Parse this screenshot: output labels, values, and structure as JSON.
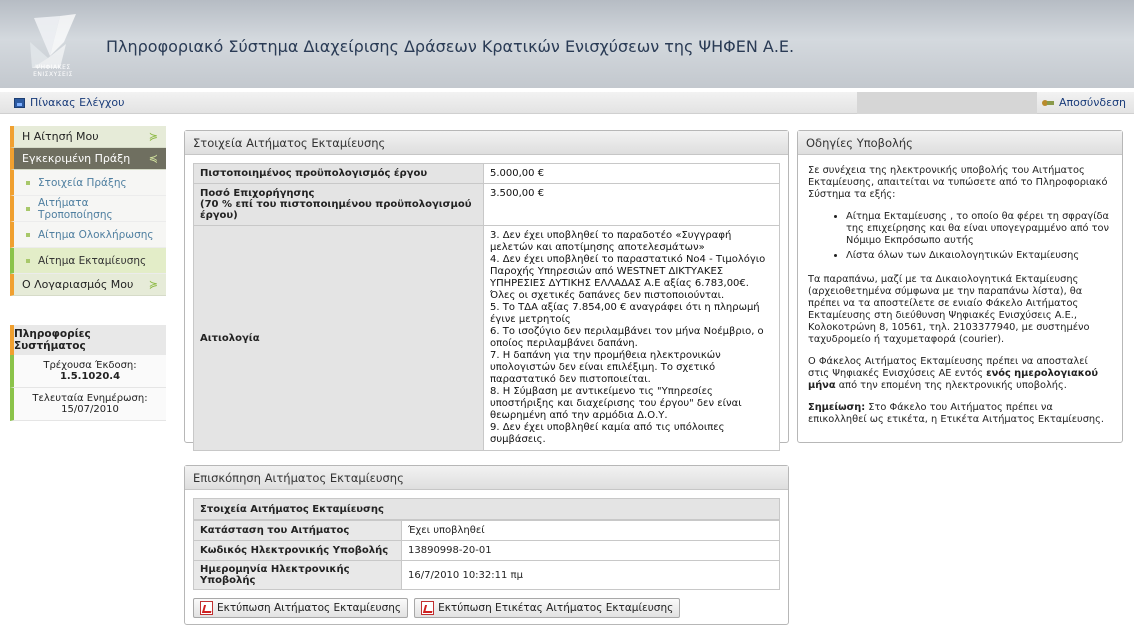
{
  "header": {
    "logo_text": "ΨΗΦΙΑΚΕΣ ΕΝΙΣΧΥΣΕΙΣ",
    "title": "Πληροφοριακό Σύστημα Διαχείρισης Δράσεων Κρατικών Ενισχύσεων της ΨΗΦΕΝ Α.Ε."
  },
  "toolbar": {
    "dashboard": "Πίνακας Ελέγχου",
    "logout": "Αποσύνδεση"
  },
  "nav": {
    "items": [
      {
        "label": "Η Αίτησή Μου",
        "chev": "≽"
      },
      {
        "label": "Εγκεκριμένη Πράξη",
        "chev": "≼"
      }
    ],
    "sub": [
      "Στοιχεία Πράξης",
      "Αιτήματα Τροποποίησης",
      "Αίτημα Ολοκλήρωσης",
      "Αίτημα Εκταμίευσης"
    ],
    "account": {
      "label": "Ο Λογαριασμός Μου",
      "chev": "≽"
    }
  },
  "sysinfo": {
    "title": "Πληροφορίες Συστήματος",
    "version_label": "Τρέχουσα Έκδοση:",
    "version": "1.5.1020.4",
    "update_label": "Τελευταία Ενημέρωση:",
    "update_date": "15/07/2010"
  },
  "main": {
    "title": "Στοιχεία Αιτήματος Εκταμίευσης",
    "budget_label": "Πιστοποιημένος προϋπολογισμός έργου",
    "budget_value": "5.000,00 €",
    "grant_label_1": "Ποσό Επιχορήγησης",
    "grant_label_2": "(70 % επί του πιστοποιημένου προϋπολογισμού έργου)",
    "grant_value": "3.500,00 €",
    "reason_label": "Αιτιολογία",
    "reasons": [
      "3. Δεν έχει υποβληθεί το παραδοτέο «Συγγραφή μελετών και αποτίμησης αποτελεσμάτων»",
      "4. Δεν έχει υποβληθεί το παραστατικό Νο4 - Τιμολόγιο Παροχής Υπηρεσιών από WESTNET ΔΙΚΤΥΑΚΕΣ ΥΠΗΡΕΣΙΕΣ ΔΥΤΙΚΗΣ ΕΛΛΑΔΑΣ Α.Ε αξίας 6.783,00€. Όλες οι σχετικές δαπάνες δεν πιστοποιούνται.",
      "5. Το ΤΔΑ αξίας 7.854,00 € αναγράφει ότι η πληρωμή έγινε μετρητοίς",
      "6. Το ισοζύγιο δεν περιλαμβάνει τον μήνα Νοέμβριο, ο οποίος περιλαμβάνει δαπάνη.",
      "7. Η δαπάνη για την προμήθεια ηλεκτρονικών υπολογιστών δεν είναι επιλέξιμη. Το σχετικό παραστατικό δεν πιστοποιείται.",
      "8. Η Σύμβαση με αντικείμενο τις \"Υπηρεσίες υποστήριξης και διαχείρισης του έργου\" δεν είναι θεωρημένη από την αρμόδια Δ.Ο.Υ.",
      "9. Δεν έχει υποβληθεί καμία από τις υπόλοιπες συμβάσεις."
    ]
  },
  "help": {
    "title": "Οδηγίες Υποβολής",
    "intro": "Σε συνέχεια της ηλεκτρονικής υποβολής του Αιτήματος Εκταμίευσης, απαιτείται να τυπώσετε από το Πληροφοριακό Σύστημα τα εξής:",
    "bullets": [
      "Αίτημα Εκταμίευσης , το οποίο θα φέρει τη σφραγίδα της επιχείρησης και θα είναι υπογεγραμμένο από τον Νόμιμο Εκπρόσωπο αυτής",
      "Λίστα όλων των Δικαιολογητικών Εκταμίευσης"
    ],
    "para2": "Τα παραπάνω, μαζί με τα Δικαιολογητικά Εκταμίευσης (αρχειοθετημένα σύμφωνα με την παραπάνω λίστα), θα πρέπει να τα αποστείλετε σε ενιαίο Φάκελο Αιτήματος Εκταμίευσης στη διεύθυνση Ψηφιακές Ενισχύσεις Α.Ε., Κολοκοτρώνη 8, 10561, τηλ. 2103377940, με συστημένο ταχυδρομείο ή ταχυμεταφορά (courier).",
    "para3_a": "Ο Φάκελος Αιτήματος Εκταμίευσης πρέπει να αποσταλεί στις Ψηφιακές Ενισχύσεις ΑΕ εντός ",
    "para3_b": "ενός ημερολογιακού μήνα",
    "para3_c": " από την επομένη της ηλεκτρονικής υποβολής.",
    "note_label": "Σημείωση:",
    "note": " Στο Φάκελο του Αιτήματος πρέπει να επικολληθεί ως ετικέτα, η Ετικέτα Αιτήματος Εκταμίευσης."
  },
  "overview": {
    "title": "Επισκόπηση Αιτήματος Εκταμίευσης",
    "subtitle": "Στοιχεία Αιτήματος Εκταμίευσης",
    "rows": [
      {
        "label": "Κατάσταση του Αιτήματος",
        "value": "Έχει υποβληθεί"
      },
      {
        "label": "Κωδικός Ηλεκτρονικής Υποβολής",
        "value": "13890998-20-01"
      },
      {
        "label": "Ημερομηνία Ηλεκτρονικής Υποβολής",
        "value": "16/7/2010 10:32:11 πμ"
      }
    ],
    "btn_print_request": "Εκτύπωση Αιτήματος Εκταμίευσης",
    "btn_print_label": "Εκτύπωση Ετικέτας Αιτήματος Εκταμίευσης"
  }
}
